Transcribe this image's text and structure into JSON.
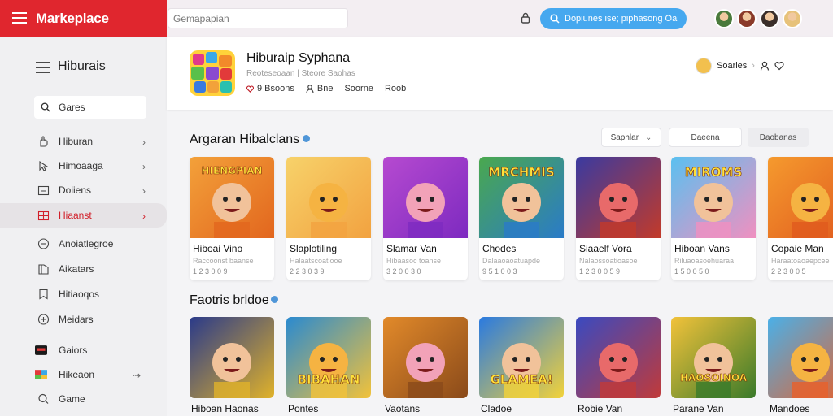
{
  "brand": {
    "name": "Markeplace"
  },
  "topbar": {
    "search_value": "Gemapapian",
    "pill_label": "Dopiunes ise; piphasong Oai",
    "avatar_colors": [
      "#4a7a3c",
      "#8a3a2a",
      "#3a2e2a",
      "#e7c27a"
    ]
  },
  "sidebar": {
    "title": "Hiburais",
    "search_value": "Gares",
    "items": [
      {
        "label": "Hiburan",
        "icon": "hand-icon",
        "chevron": true
      },
      {
        "label": "Himoaaga",
        "icon": "pointer-icon",
        "chevron": true
      },
      {
        "label": "Doiiens",
        "icon": "calendar-icon",
        "chevron": true
      },
      {
        "label": "Hiaanst",
        "icon": "grid-icon",
        "chevron": true,
        "active": true
      },
      {
        "label": "Anoiatlegroe",
        "icon": "circle-minus-icon"
      },
      {
        "label": "Aikatars",
        "icon": "book-icon"
      },
      {
        "label": "Hitiaoqos",
        "icon": "bookmark-icon"
      },
      {
        "label": "Meidars",
        "icon": "circle-plus-icon"
      },
      {
        "label": "Gaiors",
        "icon": "dark-tile-icon"
      },
      {
        "label": "Hikeaon",
        "icon": "colorful-tile-icon",
        "chevron_alt": true
      },
      {
        "label": "Game",
        "icon": "search-icon"
      }
    ]
  },
  "app": {
    "title": "Hiburaip Syphana",
    "subtitle": "Reoteseoaan | Steore Saohas",
    "meta": [
      "9 Bsoons",
      "Bne",
      "Soorne",
      "Roob"
    ],
    "user": "Soaries"
  },
  "section1": {
    "title": "Argaran Hibalclans",
    "filters": [
      "Saphlar",
      "Daeena",
      "Daobanas"
    ],
    "cards": [
      {
        "name": "Hiboai Vino",
        "sub": "Raccoonst baanse",
        "price": "1 2 3 0 0 9",
        "overlay": "HIENGPIAN",
        "bg": "#f3a13a",
        "bg2": "#e2661e"
      },
      {
        "name": "Slaplotiling",
        "sub": "Halaatscoatiooe",
        "price": "2 2 3 0 3 9",
        "overlay": "",
        "bg": "#f7d26a",
        "bg2": "#f2a240"
      },
      {
        "name": "Slamar Van",
        "sub": "Hibaasoc toanse",
        "price": "3 2 0 0 3 0",
        "overlay": "",
        "bg": "#b64ad0",
        "bg2": "#7d2ac0"
      },
      {
        "name": "Chodes",
        "sub": "Dalaaoaoatuapde",
        "price": "9 5 1 0 0 3",
        "overlay": "MRCHMIS",
        "bg": "#4aa84e",
        "bg2": "#2a7bc8"
      },
      {
        "name": "Siaaelf Vora",
        "sub": "Nalaossoatioasoe",
        "price": "1 2 3 0 0 5 9",
        "overlay": "",
        "bg": "#3a3aa0",
        "bg2": "#c23a2a"
      },
      {
        "name": "Hiboan Vans",
        "sub": "Riluaoasoehuaraa",
        "price": "1 5 0 0 5 0",
        "overlay": "MIROMS",
        "bg": "#5ac0f0",
        "bg2": "#f090c0"
      },
      {
        "name": "Copaie Man",
        "sub": "Haraatoaoaepcee",
        "price": "2 2 3 0 0 5",
        "overlay": "",
        "bg": "#f59a2e",
        "bg2": "#e05a1e"
      }
    ]
  },
  "section2": {
    "title": "Faotris brldoe",
    "cards": [
      {
        "name": "Hiboan Haonas",
        "overlay": "",
        "bg": "#2a3a8a",
        "bg2": "#e0b22a"
      },
      {
        "name": "Pontes",
        "overlay": "BIBAHAN",
        "bg": "#2a8ad0",
        "bg2": "#f2c23a"
      },
      {
        "name": "Vaotans",
        "overlay": "",
        "bg": "#e28a2a",
        "bg2": "#8a4a1a"
      },
      {
        "name": "Cladoe",
        "overlay": "GLAMEA!",
        "bg": "#2a7ae0",
        "bg2": "#f2d23a"
      },
      {
        "name": "Robie Van",
        "overlay": "",
        "bg": "#3a4ac0",
        "bg2": "#c03a3a"
      },
      {
        "name": "Parane Van",
        "overlay": "HAOSOINOA",
        "bg": "#f2c23a",
        "bg2": "#3a7a2a"
      },
      {
        "name": "Mandoes",
        "overlay": "",
        "bg": "#4ab0e8",
        "bg2": "#e8602a"
      }
    ]
  }
}
